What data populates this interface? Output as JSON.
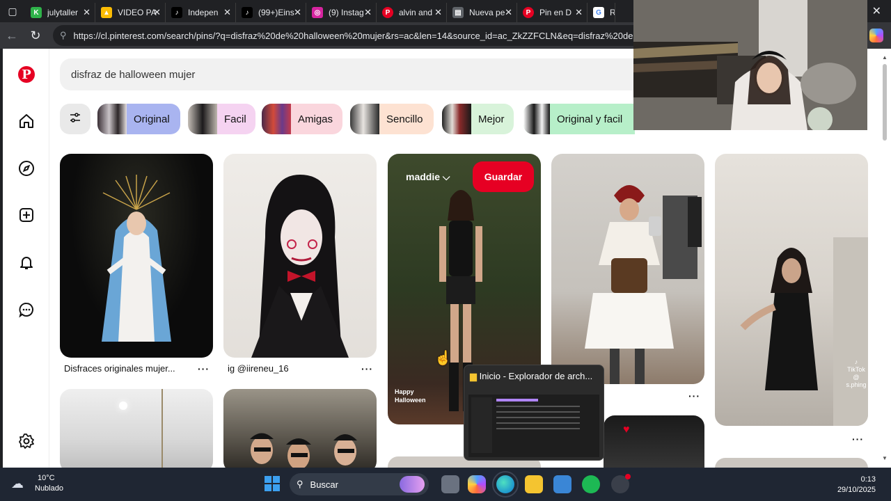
{
  "browser": {
    "tabs": [
      {
        "title": "julytaller",
        "icon": "kinedu-icon",
        "color": "#2fb34a"
      },
      {
        "title": "VIDEO PA",
        "icon": "drive-icon",
        "color": "#1a73e8"
      },
      {
        "title": "Indepen",
        "icon": "tiktok-icon",
        "color": "#000000"
      },
      {
        "title": "(99+)Eins",
        "icon": "tiktok-icon",
        "color": "#000000"
      },
      {
        "title": "(9) Instag",
        "icon": "instagram-icon",
        "color": "#d6249f"
      },
      {
        "title": "alvin and",
        "icon": "pinterest-icon",
        "color": "#e60023"
      },
      {
        "title": "Nueva pe",
        "icon": "newtab-icon",
        "color": "#5f6368"
      },
      {
        "title": "Pin en D",
        "icon": "pinterest-icon",
        "color": "#e60023"
      },
      {
        "title": "Re",
        "icon": "google-icon",
        "color": "#4285f4"
      }
    ],
    "url": "https://cl.pinterest.com/search/pins/?q=disfraz%20de%20halloween%20mujer&rs=ac&len=14&source_id=ac_ZkZZFCLN&eq=disfraz%20de"
  },
  "pinterest": {
    "search_value": "disfraz de halloween mujer",
    "chips": [
      {
        "label": "Original",
        "bg": "#a9b4f0"
      },
      {
        "label": "Facil",
        "bg": "#f5d3f1"
      },
      {
        "label": "Amigas",
        "bg": "#fad6dd"
      },
      {
        "label": "Sencillo",
        "bg": "#fde2d2"
      },
      {
        "label": "Mejor",
        "bg": "#d8f3da"
      },
      {
        "label": "Original y facil",
        "bg": "#b7efc9"
      }
    ],
    "pins": [
      {
        "caption": "Disfraces originales mujer..."
      },
      {
        "caption": "ig @iireneu_16"
      },
      {
        "caption": ""
      },
      {
        "caption": ""
      },
      {
        "caption": ""
      }
    ],
    "hover_pin": {
      "board": "maddie",
      "save_label": "Guardar",
      "overlay_text_1": "Happy",
      "overlay_text_2": "Halloween"
    },
    "tiktok_label": "TikTok",
    "tiktok_handle": "@ s.phing"
  },
  "taskbar_preview": {
    "title": "Inicio - Explorador de arch..."
  },
  "taskbar": {
    "temperature": "10°C",
    "condition": "Nublado",
    "search_label": "Buscar",
    "time": "0:13",
    "date": "29/10/2025"
  }
}
